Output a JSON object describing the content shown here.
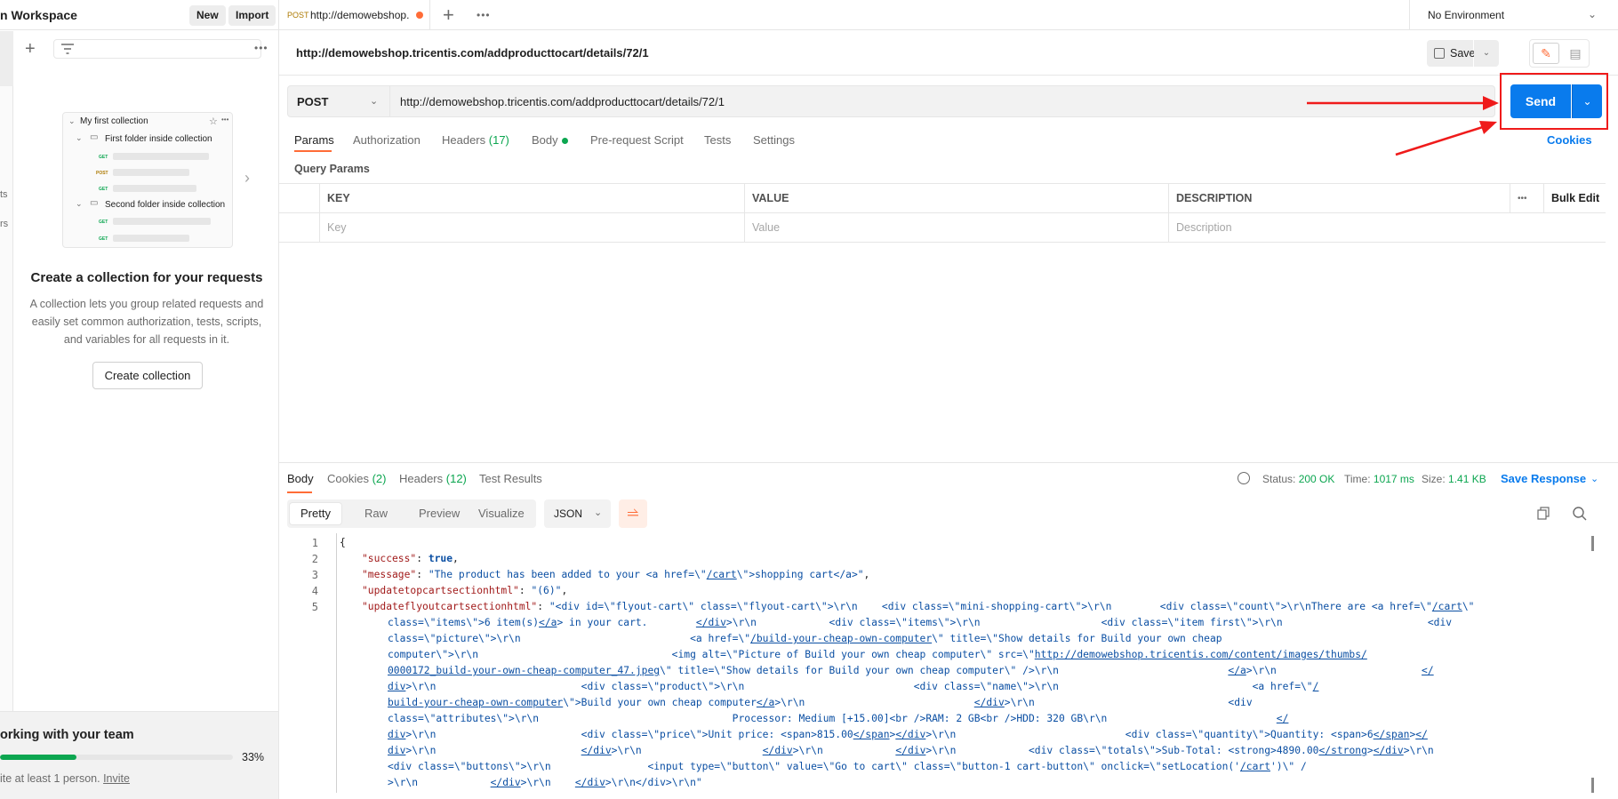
{
  "workspace": {
    "title": "n Workspace",
    "new_label": "New",
    "import_label": "Import",
    "rail_items": [
      "ts",
      "rs"
    ]
  },
  "sidebar": {
    "preview": {
      "collection": "My first collection",
      "folder1": "First folder inside collection",
      "folder2": "Second folder inside collection",
      "methods": [
        "GET",
        "POST",
        "GET",
        "GET",
        "GET"
      ]
    },
    "empty_title": "Create a collection for your requests",
    "empty_desc": "A collection lets you group related requests and easily set common authorization, tests, scripts, and variables for all requests in it.",
    "create_label": "Create collection",
    "team": {
      "title": "orking with your team",
      "progress": 0.33,
      "pct_label": "33%",
      "hint": "ite at least 1 person.",
      "invite": "Invite"
    }
  },
  "tab": {
    "method": "POST",
    "url": "http://demowebshop."
  },
  "environment": "No Environment",
  "request": {
    "title": "http://demowebshop.tricentis.com/addproducttocart/details/72/1",
    "save_label": "Save",
    "method": "POST",
    "url": "http://demowebshop.tricentis.com/addproducttocart/details/72/1",
    "send_label": "Send",
    "tabs": [
      "Params",
      "Authorization",
      "Headers",
      "Body",
      "Pre-request Script",
      "Tests",
      "Settings"
    ],
    "headers_count": "(17)",
    "cookies_label": "Cookies"
  },
  "params": {
    "label": "Query Params",
    "headers": [
      "KEY",
      "VALUE",
      "DESCRIPTION"
    ],
    "bulk_edit": "Bulk Edit",
    "placeholders": [
      "Key",
      "Value",
      "Description"
    ]
  },
  "response": {
    "tabs": [
      "Body",
      "Cookies",
      "Headers",
      "Test Results"
    ],
    "cookies_count": "(2)",
    "headers_count": "(12)",
    "status_label": "Status:",
    "status": "200 OK",
    "time_label": "Time:",
    "time": "1017 ms",
    "size_label": "Size:",
    "size": "1.41 KB",
    "save_label": "Save Response",
    "views": [
      "Pretty",
      "Raw",
      "Preview",
      "Visualize"
    ],
    "format": "JSON",
    "line_numbers": [
      "1",
      "2",
      "3",
      "4",
      "5"
    ],
    "colors": {
      "accent": "#ff6c37",
      "primary": "#097bed",
      "success": "#0ca650",
      "annotation": "#ef1b1b"
    }
  }
}
